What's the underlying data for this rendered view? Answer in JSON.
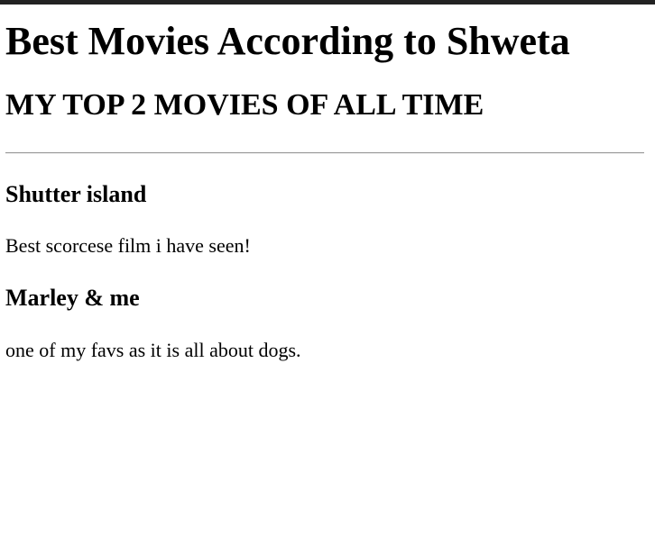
{
  "page": {
    "title": "Best Movies According to Shweta",
    "subtitle": "MY TOP 2 MOVIES OF ALL TIME"
  },
  "movies": [
    {
      "title": "Shutter island",
      "description": "Best scorcese film i have seen!"
    },
    {
      "title": "Marley & me",
      "description": "one of my favs as it is all about dogs."
    }
  ],
  "colors": {
    "top_border": "#222222",
    "divider": "#9a9a9a",
    "text": "#000000",
    "background": "#ffffff"
  }
}
